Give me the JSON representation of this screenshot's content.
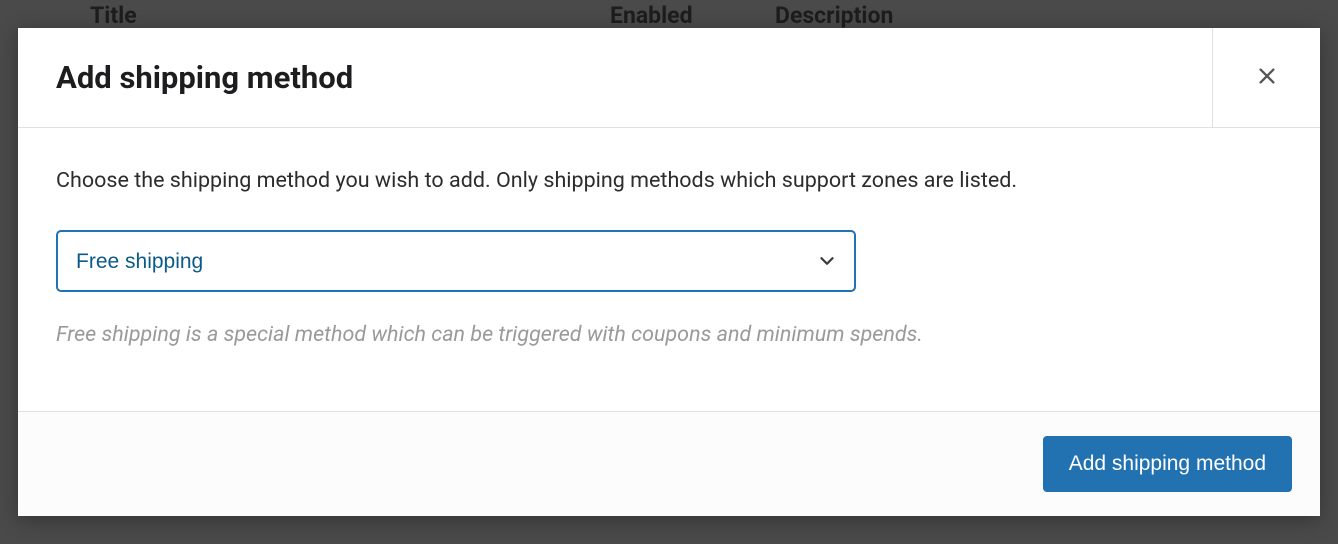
{
  "background": {
    "columns": {
      "title": "Title",
      "enabled": "Enabled",
      "description": "Description"
    }
  },
  "modal": {
    "title": "Add shipping method",
    "description": "Choose the shipping method you wish to add. Only shipping methods which support zones are listed.",
    "select": {
      "value": "Free shipping",
      "options": [
        "Free shipping"
      ]
    },
    "help_text": "Free shipping is a special method which can be triggered with coupons and minimum spends.",
    "footer": {
      "add_button": "Add shipping method"
    }
  }
}
